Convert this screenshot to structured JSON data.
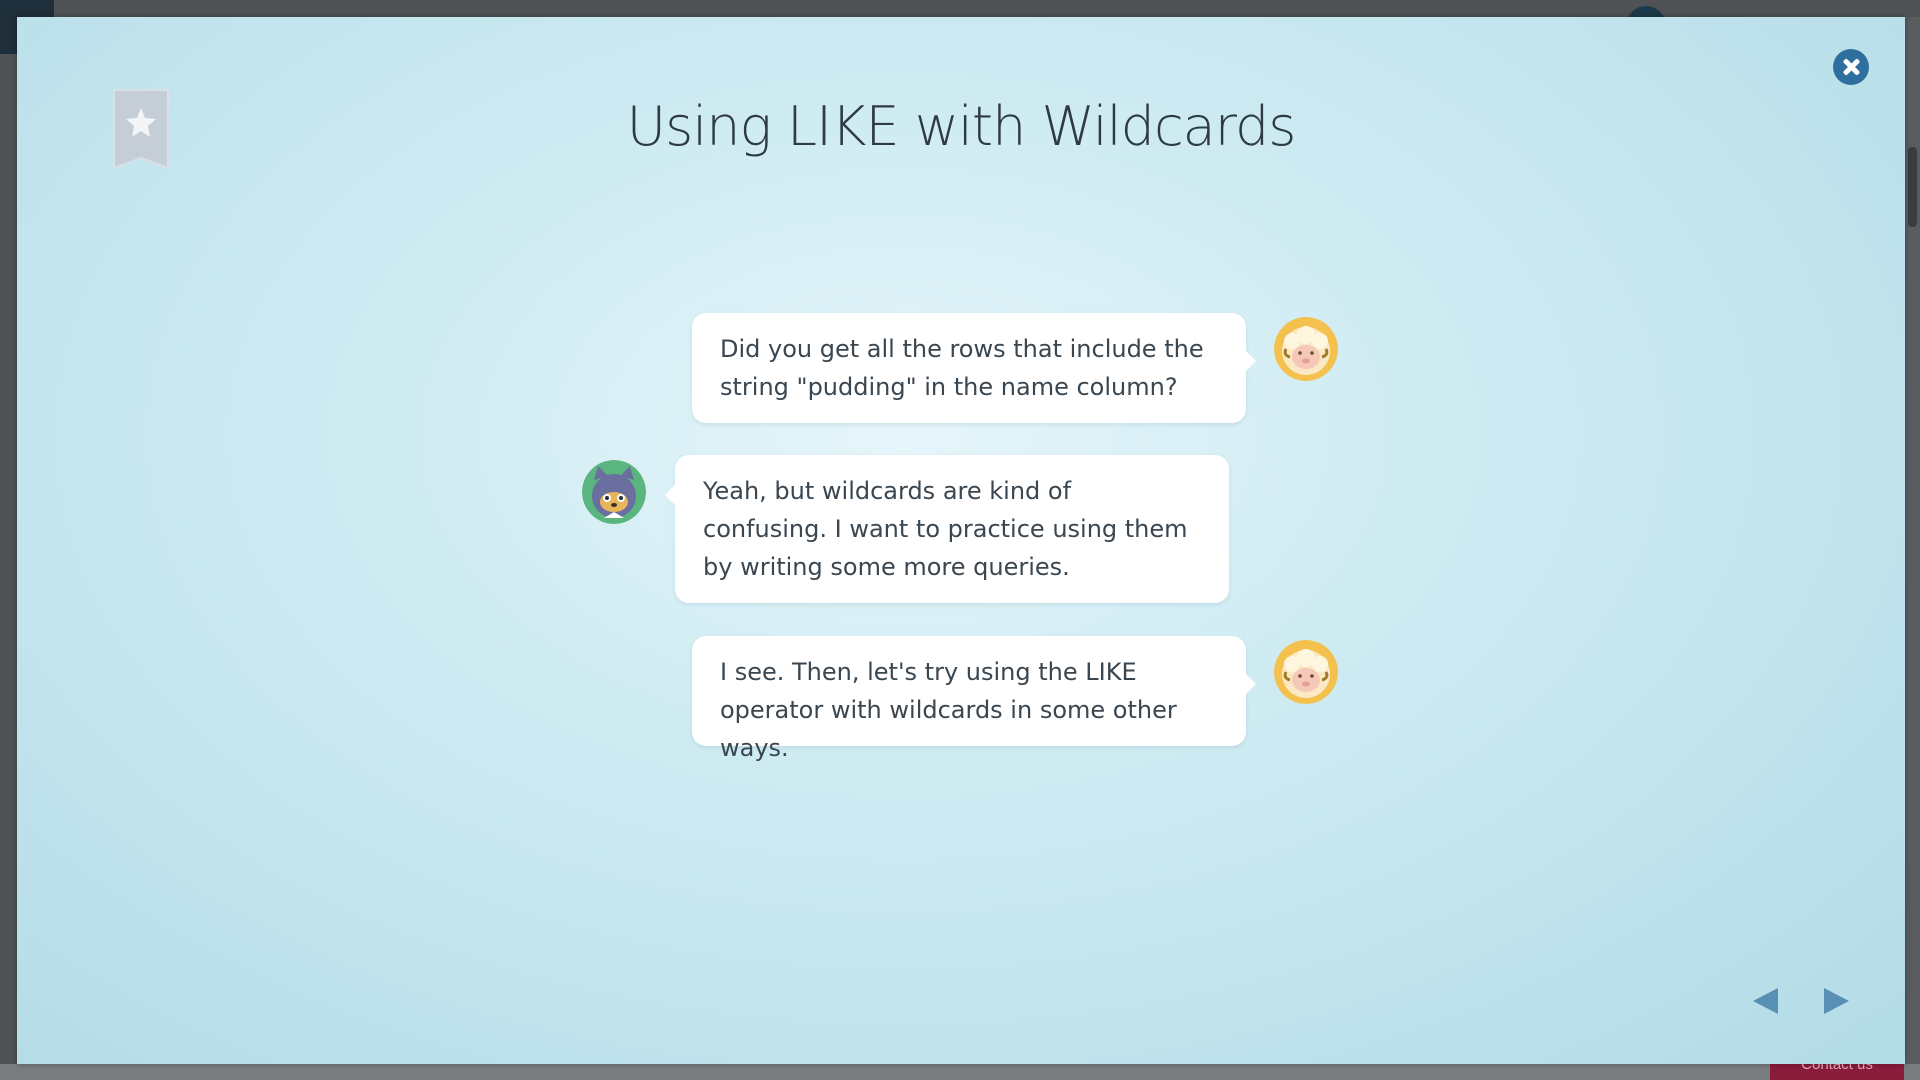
{
  "modal": {
    "title": "Using LIKE with Wildcards"
  },
  "conversation": [
    {
      "speaker": "sheep",
      "text": "Did you get all the rows that include the string \"pudding\" in the name column?"
    },
    {
      "speaker": "cat",
      "text": "Yeah, but wildcards are kind of confusing. I want to practice using them by writing some more queries."
    },
    {
      "speaker": "sheep",
      "text": "I see. Then, let's try using the LIKE operator with wildcards in some other ways."
    }
  ],
  "background": {
    "contact_label": "Contact us"
  },
  "icons": {
    "bookmark": "bookmark-star-icon",
    "close": "close-icon",
    "prev": "triangle-left-icon",
    "next": "triangle-right-icon"
  },
  "colors": {
    "close_button": "#2f6f9f",
    "nav_arrow": "#5a8fb5",
    "bookmark": "#c5cdd6"
  }
}
